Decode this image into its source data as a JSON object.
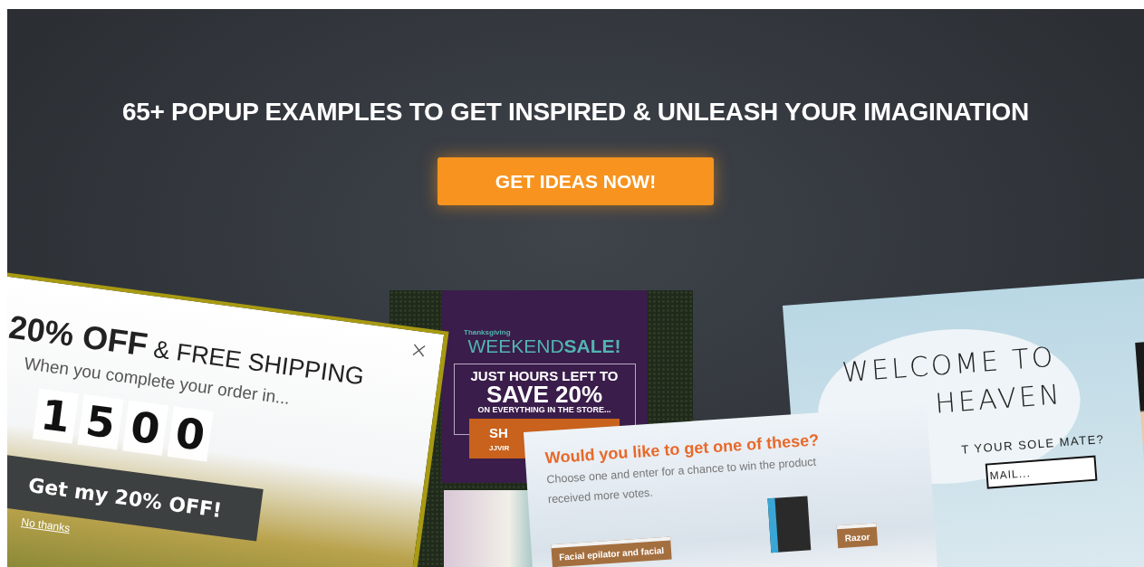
{
  "banner": {
    "headline": "65+ POPUP EXAMPLES TO GET INSPIRED & UNLEASH YOUR IMAGINATION",
    "cta": "GET IDEAS NOW!"
  },
  "popups": [
    {
      "kind": "sale",
      "eyebrow": "Thanksgiving",
      "title_light": "WEEKEND",
      "title_bold": "SALE!",
      "line1": "JUST HOURS LEFT TO",
      "line2": "SAVE 20%",
      "line3": "ON EVERYTHING IN THE STORE...",
      "button": "SH",
      "button_sub": "JJVIR"
    },
    {
      "kind": "welcome",
      "title_lines": [
        "WELCOME TO",
        "HEAVEN"
      ],
      "question": "T YOUR SOLE MATE?",
      "placeholder": "MAIL..."
    },
    {
      "kind": "countdown",
      "title_bold": "20% OFF",
      "title_rest": "& FREE SHIPPING",
      "subtitle": "When you complete your order in...",
      "digits": [
        "1",
        "5",
        "0",
        "0"
      ],
      "button": "Get my 20% OFF!",
      "dismiss": "No thanks"
    },
    {
      "kind": "vote",
      "title": "Would you like to get one of these?",
      "text": "Choose one and enter for a chance to win the product received more votes.",
      "signs": [
        "Facial epilator and facial",
        "Razor"
      ]
    }
  ]
}
